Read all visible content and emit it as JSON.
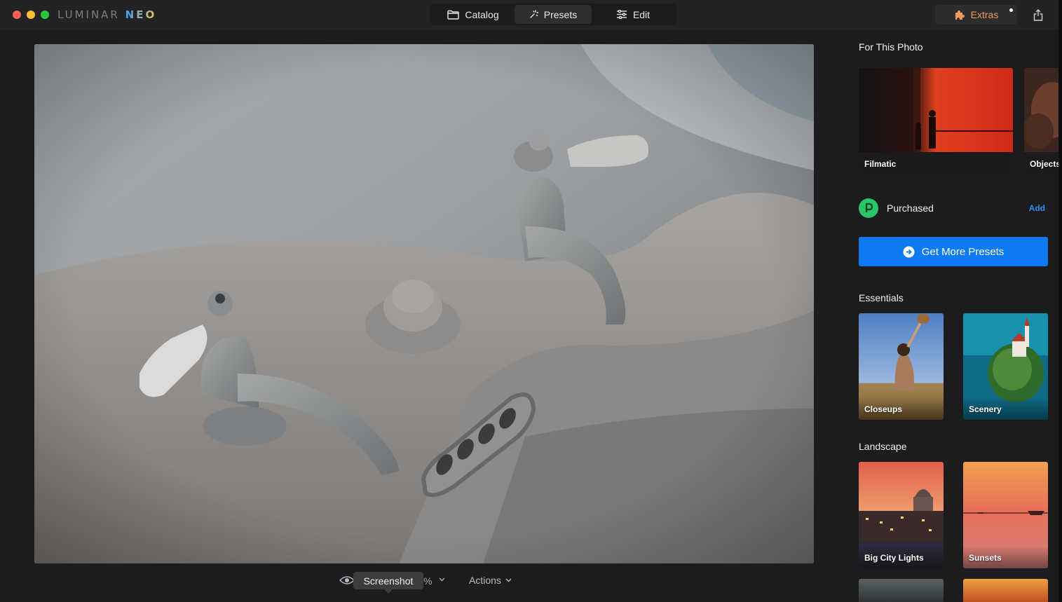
{
  "window": {
    "logo_part1": "LUMINAR ",
    "logo_part2": "NEO"
  },
  "topnav": {
    "tabs": [
      {
        "label": "Catalog",
        "icon": "folder-icon"
      },
      {
        "label": "Presets",
        "icon": "sparkle-icon",
        "active": true
      },
      {
        "label": "Edit",
        "icon": "sliders-icon"
      }
    ]
  },
  "header": {
    "extras_label": "Extras",
    "extras_color": "#f09a5a"
  },
  "bottombar": {
    "tooltip": "Screenshot",
    "zoom_fragment": "%",
    "actions_label": "Actions"
  },
  "panel": {
    "for_this_photo_title": "For This Photo",
    "for_this_photo": [
      {
        "label": "Filmatic"
      },
      {
        "label": "Objects"
      }
    ],
    "purchased": {
      "label": "Purchased",
      "add_label": "Add",
      "icon_color": "#29c46b"
    },
    "get_more_label": "Get More Presets",
    "accent_color": "#0f7bf2",
    "essentials_title": "Essentials",
    "essentials": [
      {
        "label": "Closeups"
      },
      {
        "label": "Scenery"
      }
    ],
    "landscape_title": "Landscape",
    "landscape": [
      {
        "label": "Big City Lights"
      },
      {
        "label": "Sunsets"
      }
    ]
  }
}
